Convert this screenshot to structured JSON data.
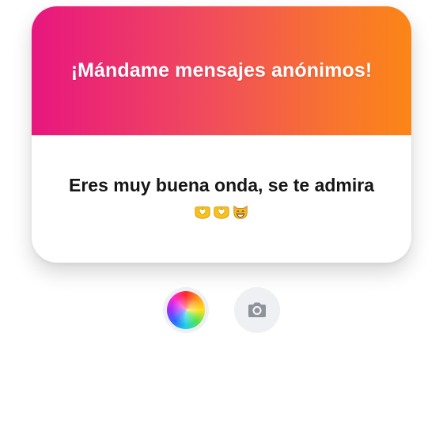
{
  "card": {
    "header_title": "¡Mándame mensajes anónimos!",
    "message": "Eres muy buena onda, se te admira",
    "emojis": [
      "heart-hands-emoji",
      "heart-hands-emoji",
      "grinning-cat-emoji"
    ]
  },
  "controls": {
    "color_picker_icon": "color-wheel-icon",
    "camera_icon": "camera-icon"
  },
  "colors": {
    "gradient_start": "#e8167f",
    "gradient_end": "#fb8617",
    "button_bg": "#eef0f3",
    "icon_gray": "#8e939b"
  }
}
